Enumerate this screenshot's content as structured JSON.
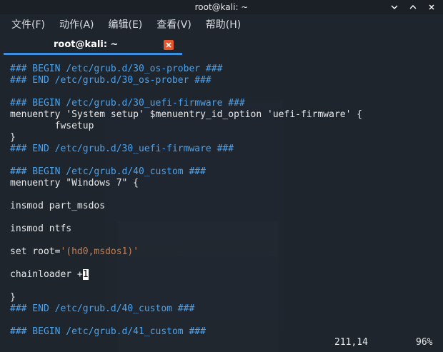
{
  "window": {
    "title": "root@kali: ~"
  },
  "menu": {
    "items": [
      "文件(F)",
      "动作(A)",
      "编辑(E)",
      "查看(V)",
      "帮助(H)"
    ]
  },
  "tab": {
    "label": "root@kali: ~"
  },
  "editor": {
    "lines": [
      {
        "text": "### BEGIN /etc/grub.d/30_os-prober ###",
        "kind": "comment"
      },
      {
        "text": "### END /etc/grub.d/30_os-prober ###",
        "kind": "comment"
      },
      {
        "text": "",
        "kind": "plain"
      },
      {
        "text": "### BEGIN /etc/grub.d/30_uefi-firmware ###",
        "kind": "comment"
      },
      {
        "text": "menuentry 'System setup' $menuentry_id_option 'uefi-firmware' {",
        "kind": "plain"
      },
      {
        "text": "        fwsetup",
        "kind": "plain"
      },
      {
        "text": "}",
        "kind": "plain"
      },
      {
        "text": "### END /etc/grub.d/30_uefi-firmware ###",
        "kind": "comment"
      },
      {
        "text": "",
        "kind": "plain"
      },
      {
        "text": "### BEGIN /etc/grub.d/40_custom ###",
        "kind": "comment"
      },
      {
        "text": "menuentry \"Windows 7\" {",
        "kind": "plain"
      },
      {
        "text": "",
        "kind": "plain"
      },
      {
        "text": "insmod part_msdos",
        "kind": "plain"
      },
      {
        "text": "",
        "kind": "plain"
      },
      {
        "text": "insmod ntfs",
        "kind": "plain"
      },
      {
        "text": "",
        "kind": "plain"
      },
      {
        "text": "set root=",
        "kind": "plain",
        "string": "'(hd0,msdos1)'"
      },
      {
        "text": "",
        "kind": "plain"
      },
      {
        "text": "chainloader +",
        "kind": "plain",
        "cursor": "1"
      },
      {
        "text": "",
        "kind": "plain"
      },
      {
        "text": "}",
        "kind": "plain"
      },
      {
        "text": "### END /etc/grub.d/40_custom ###",
        "kind": "comment"
      },
      {
        "text": "",
        "kind": "plain"
      },
      {
        "text": "### BEGIN /etc/grub.d/41_custom ###",
        "kind": "comment"
      }
    ],
    "position": "211,14",
    "percent": "96%"
  },
  "colors": {
    "comment": "#4aa3f0",
    "string": "#c77d4e",
    "accent": "#3b8fe0",
    "close": "#e8562a"
  }
}
